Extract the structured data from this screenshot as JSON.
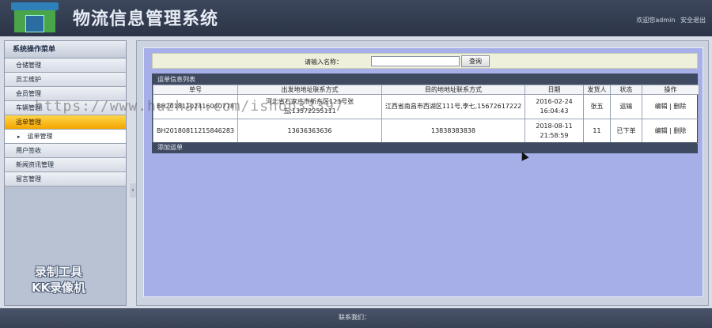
{
  "header": {
    "title": "物流信息管理系统",
    "welcome": "欢迎您admin",
    "logout": "安全退出"
  },
  "sidebar": {
    "title": "系统操作菜单",
    "items": [
      {
        "label": "仓储管理"
      },
      {
        "label": "员工维护"
      },
      {
        "label": "会员管理"
      },
      {
        "label": "车辆管理"
      },
      {
        "label": "运单管理"
      },
      {
        "label": "运单管理"
      },
      {
        "label": "用户签收"
      },
      {
        "label": "新闻资讯管理"
      },
      {
        "label": "留言管理"
      }
    ],
    "watermark_line1": "录制工具",
    "watermark_line2": "KK录像机"
  },
  "search": {
    "label": "请输入名称：",
    "value": "",
    "button": "查询"
  },
  "list": {
    "title": "运单信息列表",
    "columns": [
      "单号",
      "出发地地址联系方式",
      "目的地地址联系方式",
      "日期",
      "发货人",
      "状态",
      "操作"
    ],
    "rows": [
      {
        "id": "BH20181102416040778",
        "from": "河北省石家庄市新东区123号张五,13572255111",
        "to": "江西省南昌市西湖区111号,李七,15672617222",
        "date": "2016-02-24",
        "time": "16:04:43",
        "sender": "张五",
        "status": "运输",
        "edit": "编辑",
        "sep": "|",
        "delete": "删除"
      },
      {
        "id": "BH20180811215846283",
        "from": "13636363636",
        "to": "13838383838",
        "date": "2018-08-11",
        "time": "21:58:59",
        "sender": "11",
        "status": "已下单",
        "edit": "编辑",
        "sep": "|",
        "delete": "删除"
      }
    ],
    "add_label": "添加运单"
  },
  "overlay_watermark": "https://www.huzhan.com/ishop33397",
  "footer": {
    "text": "联系我们："
  }
}
